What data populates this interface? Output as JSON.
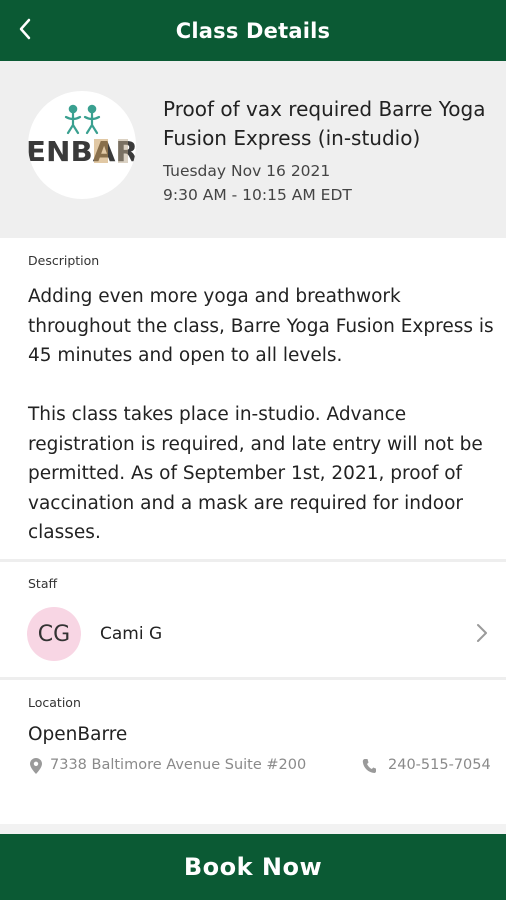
{
  "topbar": {
    "title": "Class Details",
    "back_icon": "chevron-left-icon"
  },
  "class": {
    "name": "Proof of vax required Barre Yoga Fusion Express (in-studio)",
    "date": "Tuesday Nov 16 2021",
    "time": "9:30 AM - 10:15 AM EDT",
    "logo_text": "ENBAR"
  },
  "description": {
    "label": "Description",
    "text": "Adding even more yoga and breathwork throughout the class, Barre Yoga Fusion Express is 45 minutes and open to all levels.\n\nThis class takes place in-studio. Advance registration is required, and late entry will not be permitted. As of September 1st, 2021, proof of vaccination and a mask are required for indoor classes."
  },
  "staff": {
    "label": "Staff",
    "initials": "CG",
    "name": "Cami G",
    "avatar_color": "#f8d6e4"
  },
  "location": {
    "label": "Location",
    "name": "OpenBarre",
    "address": "7338 Baltimore Avenue Suite #200",
    "phone": "240-515-7054"
  },
  "actions": {
    "book_label": "Book Now"
  },
  "colors": {
    "brand": "#0b5a34",
    "header_bg": "#efefef",
    "muted_text": "#8a8a8a"
  }
}
